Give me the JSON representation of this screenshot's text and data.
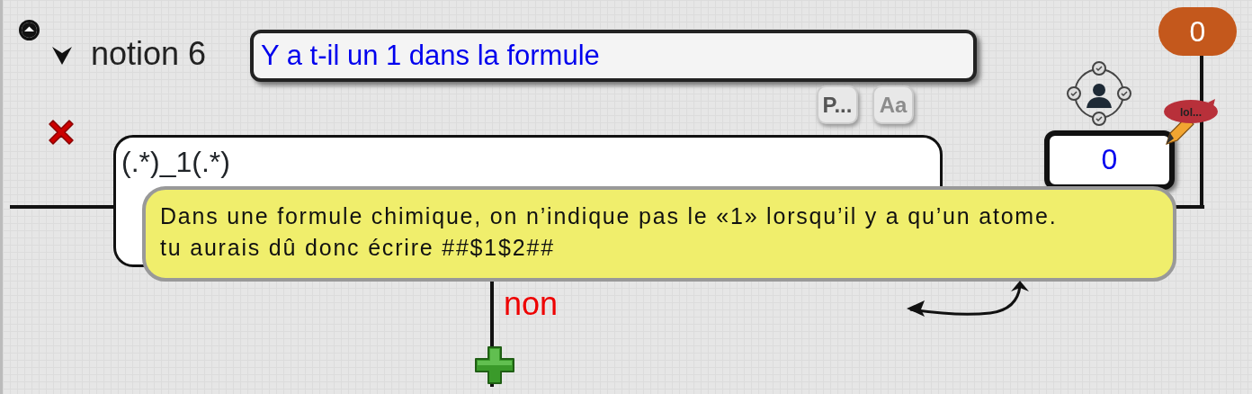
{
  "node": {
    "expanded": true,
    "label": "notion 6"
  },
  "title_field": {
    "value": "Y a t-il un 1 dans la formule"
  },
  "tool_buttons": [
    {
      "label": "P...",
      "disabled": false
    },
    {
      "label": "Aa",
      "disabled": true
    }
  ],
  "pattern_field": {
    "value": "(.*)_1(.*)"
  },
  "score_field": {
    "value": "0"
  },
  "counter_badge": "0",
  "note_label": "lol...",
  "tooltip": {
    "text": "Dans une formule chimique, on n’indique pas le «1» lorsqu’il y a qu’un atome.\ntu aurais dû donc écrire ##$1$2##"
  },
  "branch": {
    "label": "non"
  }
}
